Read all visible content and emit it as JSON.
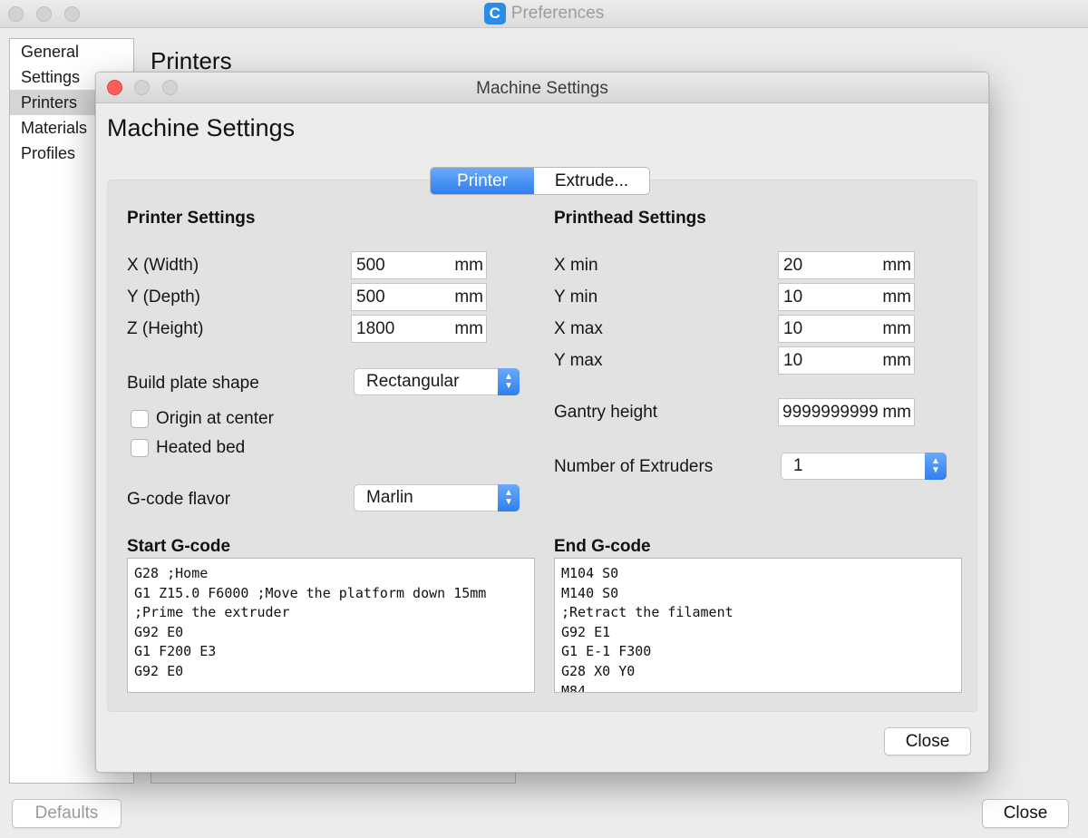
{
  "preferences": {
    "title": "Preferences",
    "app_icon": "cura-logo-icon",
    "heading": "Printers",
    "sidebar": [
      {
        "label": "General",
        "selected": false
      },
      {
        "label": "Settings",
        "selected": false
      },
      {
        "label": "Printers",
        "selected": true
      },
      {
        "label": "Materials",
        "selected": false
      },
      {
        "label": "Profiles",
        "selected": false
      }
    ],
    "defaults_button": "Defaults",
    "close_button": "Close"
  },
  "dialog": {
    "window_title": "Machine Settings",
    "heading": "Machine Settings",
    "tabs": [
      {
        "label": "Printer",
        "active": true
      },
      {
        "label": "Extrude...",
        "active": false
      }
    ],
    "printer_settings": {
      "title": "Printer Settings",
      "x_width": {
        "label": "X (Width)",
        "value": "500",
        "unit": "mm"
      },
      "y_depth": {
        "label": "Y (Depth)",
        "value": "500",
        "unit": "mm"
      },
      "z_height": {
        "label": "Z (Height)",
        "value": "1800",
        "unit": "mm"
      },
      "build_plate_shape": {
        "label": "Build plate shape",
        "value": "Rectangular"
      },
      "origin_at_center": {
        "label": "Origin at center",
        "checked": false
      },
      "heated_bed": {
        "label": "Heated bed",
        "checked": false
      },
      "gcode_flavor": {
        "label": "G-code flavor",
        "value": "Marlin"
      }
    },
    "printhead_settings": {
      "title": "Printhead Settings",
      "x_min": {
        "label": "X min",
        "value": "20",
        "unit": "mm"
      },
      "y_min": {
        "label": "Y min",
        "value": "10",
        "unit": "mm"
      },
      "x_max": {
        "label": "X max",
        "value": "10",
        "unit": "mm"
      },
      "y_max": {
        "label": "Y max",
        "value": "10",
        "unit": "mm"
      },
      "gantry_height": {
        "label": "Gantry height",
        "value": "9999999999",
        "unit": "mm"
      },
      "number_of_extruders": {
        "label": "Number of Extruders",
        "value": "1"
      }
    },
    "start_gcode": {
      "title": "Start G-code",
      "lines": [
        "G28 ;Home",
        "G1 Z15.0 F6000 ;Move the platform down 15mm",
        ";Prime the extruder",
        "G92 E0",
        "G1 F200 E3",
        "G92 E0"
      ]
    },
    "end_gcode": {
      "title": "End G-code",
      "lines": [
        "M104 S0",
        "M140 S0",
        ";Retract the filament",
        "G92 E1",
        "G1 E-1 F300",
        "G28 X0 Y0",
        "M84"
      ]
    },
    "close_button": "Close"
  },
  "colors": {
    "accent_blue": "#2f7ff0",
    "close_red": "#fc5f57",
    "window_bg": "#ececec",
    "panel_bg": "#e2e2e2"
  }
}
